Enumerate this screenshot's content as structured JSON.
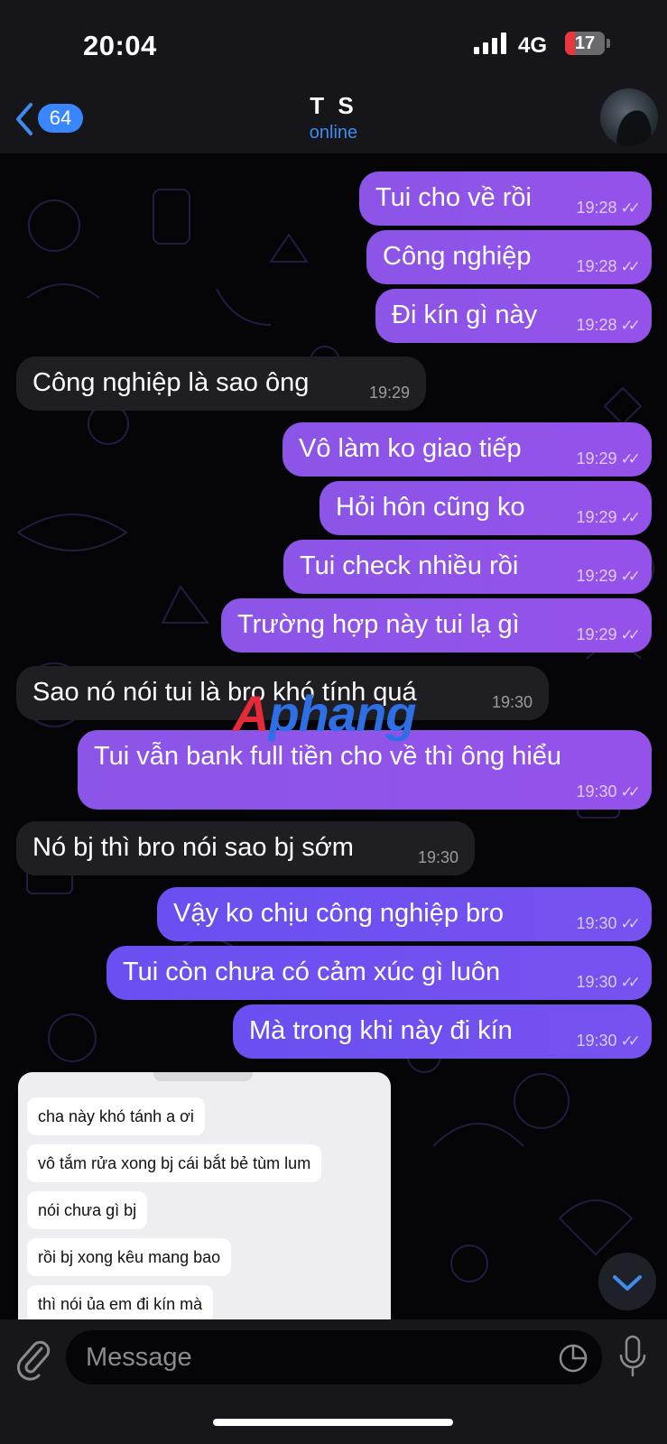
{
  "status_bar": {
    "time": "20:04",
    "network": "4G",
    "battery": "17"
  },
  "header": {
    "back_badge": "64",
    "title": "T S",
    "subtitle": "online"
  },
  "messages": [
    {
      "text": "Tui cho về rồi",
      "time": "19:28",
      "dir": "out"
    },
    {
      "text": "Công nghiệp",
      "time": "19:28",
      "dir": "out"
    },
    {
      "text": "Đi kín gì này",
      "time": "19:28",
      "dir": "out"
    },
    {
      "text": "Công nghiệp là sao ông",
      "time": "19:29",
      "dir": "in"
    },
    {
      "text": "Vô làm ko giao tiếp",
      "time": "19:29",
      "dir": "out"
    },
    {
      "text": "Hỏi hôn cũng ko",
      "time": "19:29",
      "dir": "out"
    },
    {
      "text": "Tui check nhiều rồi",
      "time": "19:29",
      "dir": "out"
    },
    {
      "text": "Trường hợp này tui lạ gì",
      "time": "19:29",
      "dir": "out"
    },
    {
      "text": "Sao nó nói tui là bro khó tính quá",
      "time": "19:30",
      "dir": "in"
    },
    {
      "text": "Tui vẫn bank full tiền cho về thì ông hiểu",
      "time": "19:30",
      "dir": "out"
    },
    {
      "text": "Nó bj thì bro nói sao bj sớm",
      "time": "19:30",
      "dir": "in"
    },
    {
      "text": "Vậy ko chịu công nghiệp bro",
      "time": "19:30",
      "dir": "out"
    },
    {
      "text": "Tui còn chưa có cảm xúc gì luôn",
      "time": "19:30",
      "dir": "out"
    },
    {
      "text": "Mà trong khi này đi kín",
      "time": "19:30",
      "dir": "out"
    }
  ],
  "watermark": {
    "part1": "A",
    "part2": "phang"
  },
  "screenshot_card": {
    "messages": [
      "cha này khó tánh a ơi",
      "vô tắm rửa xong bj cái bắt bẻ tùm lum",
      "nói chưa gì bj",
      "rồi bj xong kêu mang bao",
      "thì nói ủa em đi kín mà"
    ]
  },
  "input": {
    "placeholder": "Message"
  },
  "icons": {
    "back": "chevron-left-icon",
    "attach": "paperclip-icon",
    "sticker": "sticker-icon",
    "mic": "microphone-icon",
    "scroll": "chevron-down-icon"
  },
  "colors": {
    "outgoing": "#8b55e8",
    "incoming": "#1f1f23",
    "accent": "#3a86ff",
    "background": "#050507"
  }
}
